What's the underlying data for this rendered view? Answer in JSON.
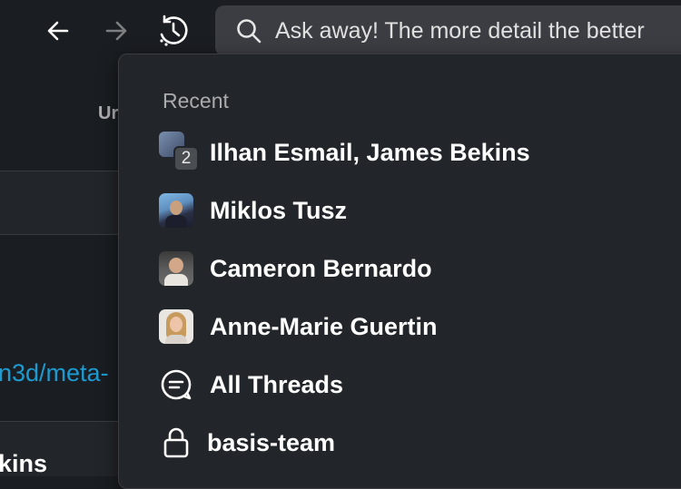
{
  "toolbar": {
    "back_icon": "arrow-left-icon",
    "forward_icon": "arrow-right-icon",
    "history_icon": "history-clock-icon"
  },
  "search": {
    "placeholder": "Ask away! The more detail the better",
    "icon": "search-icon"
  },
  "background": {
    "partial_header": "Ur",
    "partial_link": "n3d/meta-",
    "partial_name": "kins",
    "link_color": "#1d9bd1"
  },
  "dropdown": {
    "section_label": "Recent",
    "items": [
      {
        "label": "Ilhan Esmail, James Bekins",
        "type": "group-dm",
        "count": "2"
      },
      {
        "label": "Miklos Tusz",
        "type": "dm"
      },
      {
        "label": "Cameron Bernardo",
        "type": "dm"
      },
      {
        "label": "Anne-Marie Guertin",
        "type": "dm"
      },
      {
        "label": "All Threads",
        "type": "threads",
        "icon": "threads-icon"
      },
      {
        "label": "basis-team",
        "type": "private-channel",
        "icon": "lock-icon"
      }
    ]
  },
  "colors": {
    "background": "#1a1d21",
    "dropdown": "#222529",
    "search": "#3b3d42",
    "text_primary": "#ffffff",
    "text_muted": "#ababad"
  }
}
